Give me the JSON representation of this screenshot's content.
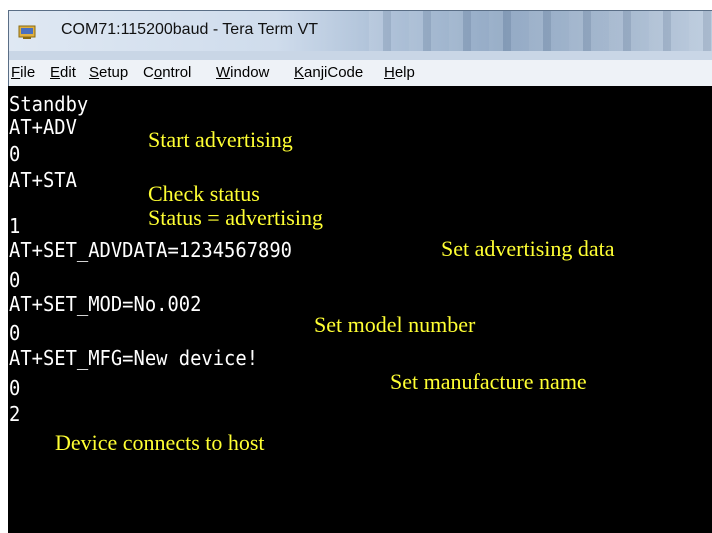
{
  "window": {
    "title": "COM71:115200baud - Tera Term VT",
    "app_icon": "tera-term-icon"
  },
  "menu": [
    {
      "label": "File",
      "mnemonic": "F",
      "rest": "ile"
    },
    {
      "label": "Edit",
      "mnemonic": "E",
      "rest": "dit"
    },
    {
      "label": "Setup",
      "mnemonic": "S",
      "rest": "etup"
    },
    {
      "label": "Control",
      "pre": "C",
      "mnemonic": "o",
      "rest": "ntrol"
    },
    {
      "label": "Window",
      "mnemonic": "W",
      "rest": "indow"
    },
    {
      "label": "KanjiCode",
      "mnemonic": "K",
      "rest": "anjiCode"
    },
    {
      "label": "Help",
      "mnemonic": "H",
      "rest": "elp"
    }
  ],
  "terminal": {
    "lines": [
      "Standby",
      "AT+ADV",
      "0",
      "AT+STA",
      "1",
      "AT+SET_ADVDATA=1234567890",
      "0",
      "AT+SET_MOD=No.002",
      "0",
      "AT+SET_MFG=New device!",
      "0",
      "2"
    ],
    "annotations": [
      "Start advertising",
      "Check status",
      "Status = advertising",
      "Set advertising data",
      "Set model number",
      "Set manufacture name",
      "Device connects to host"
    ],
    "colors": {
      "background": "#000000",
      "text": "#ffffff",
      "annotation": "#ffff33"
    }
  }
}
